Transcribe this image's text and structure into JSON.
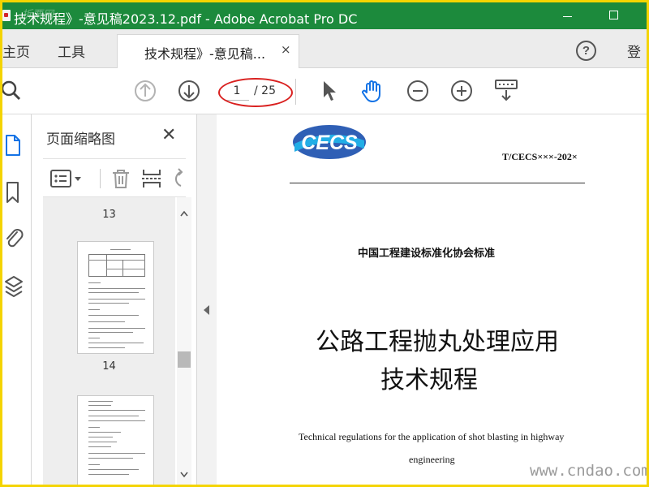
{
  "window": {
    "title": "技术规程》-意见稿2023.12.pdf - Adobe Acrobat Pro DC",
    "title_watermark": "拆栗网"
  },
  "tabs": {
    "home": "主页",
    "tools": "工具",
    "document": "技术规程》-意见稿...",
    "close": "×",
    "help": "?",
    "login": "登"
  },
  "toolbar": {
    "current_page": "1",
    "total_pages": "/ 25"
  },
  "thumbnails": {
    "title": "页面缩略图",
    "close": "✕",
    "pages": [
      {
        "number": "13"
      },
      {
        "number": "14"
      }
    ]
  },
  "document": {
    "logo_text": "CECS",
    "standard_code": "T/CECS×××-202×",
    "organization": "中国工程建设标准化协会标准",
    "title_line1": "公路工程抛丸处理应用",
    "title_line2": "技术规程",
    "english_title_line1": "Technical regulations for the application of shot blasting in highway",
    "english_title_line2": "engineering"
  },
  "watermark": "www.cndao.com",
  "colors": {
    "title_bar": "#1c8a3c",
    "screenshot_border": "#f4d400",
    "hand_tool": "#1473e6",
    "annotation_oval": "#d9201f",
    "logo_blue": "#2f5fb5",
    "logo_cyan": "#22aee6"
  },
  "icons": {
    "search": "search-icon",
    "prev_page": "arrow-up-circle-icon",
    "next_page": "arrow-down-circle-icon",
    "select": "cursor-arrow-icon",
    "hand": "hand-icon",
    "zoom_out": "zoom-out-icon",
    "zoom_in": "zoom-in-icon",
    "page_tools": "keyboard-icon"
  }
}
